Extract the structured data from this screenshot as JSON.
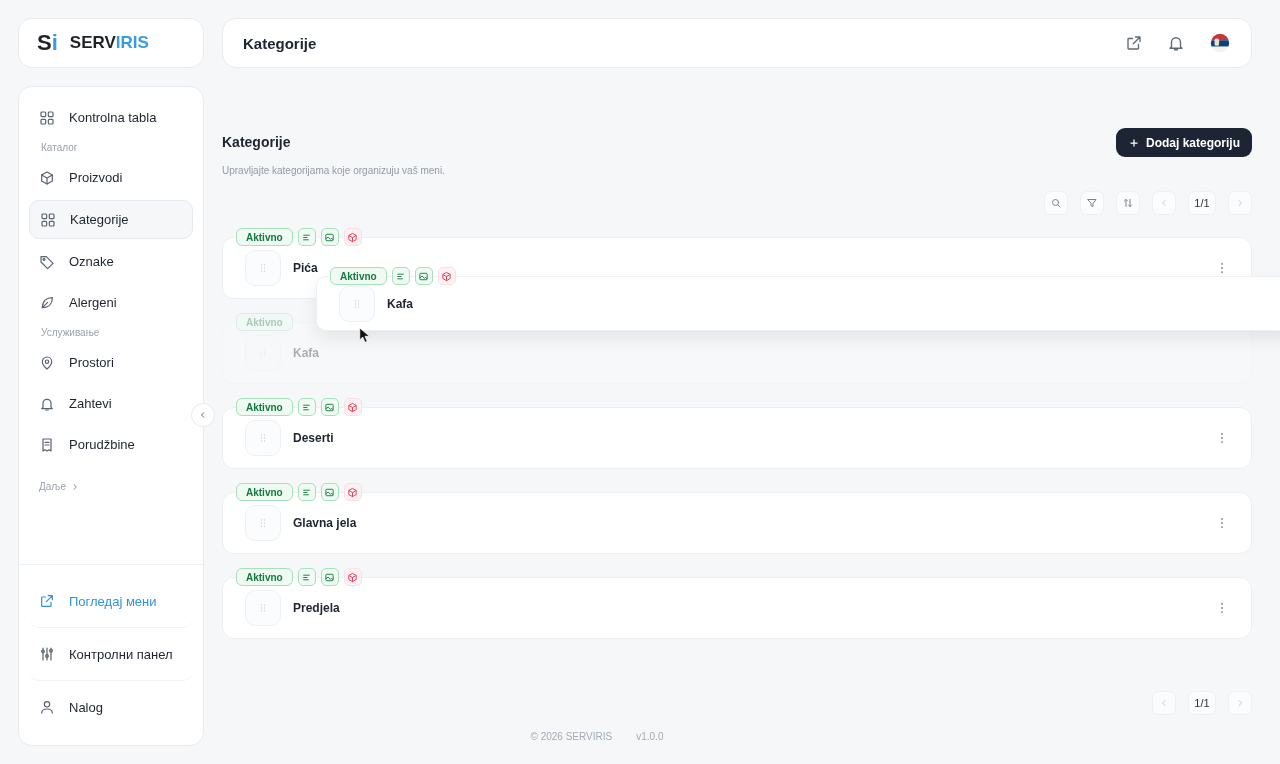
{
  "brand": {
    "mark_s": "S",
    "mark_i": "i",
    "name_a": "SERV",
    "name_b": "IRIS"
  },
  "header": {
    "title": "Kategorije"
  },
  "sidebar": {
    "items": [
      {
        "kind": "item",
        "label": "Kontrolna tabla",
        "selected": false
      },
      {
        "kind": "section",
        "label": "Каталог"
      },
      {
        "kind": "item",
        "label": "Proizvodi",
        "selected": false
      },
      {
        "kind": "item",
        "label": "Kategorije",
        "selected": true
      },
      {
        "kind": "item",
        "label": "Oznake",
        "selected": false
      },
      {
        "kind": "item",
        "label": "Alergeni",
        "selected": false
      },
      {
        "kind": "section",
        "label": "Услуживање"
      },
      {
        "kind": "item",
        "label": "Prostori",
        "selected": false
      },
      {
        "kind": "item",
        "label": "Zahtevi",
        "selected": false
      },
      {
        "kind": "item",
        "label": "Porudžbine",
        "selected": false
      },
      {
        "kind": "more",
        "label": "Даље"
      }
    ],
    "bottom": [
      {
        "kind": "link",
        "label": "Погледај мени"
      },
      {
        "kind": "item",
        "label": "Контролни панел"
      },
      {
        "kind": "item",
        "label": "Nalog"
      }
    ]
  },
  "page": {
    "title": "Kategorije",
    "subtitle": "Upravljajte kategorijama koje organizuju vaš meni.",
    "add_button": "Dodaj kategoriju"
  },
  "toolbar": {
    "page": "1/1"
  },
  "rows": [
    {
      "kind": "card",
      "status": "Aktivno",
      "has_description": true,
      "has_image": true,
      "has_products": false,
      "name": "Pića"
    },
    {
      "kind": "placeholder",
      "status": "Aktivno",
      "name": "Kafa"
    },
    {
      "kind": "card",
      "status": "Aktivno",
      "has_description": true,
      "has_image": true,
      "has_products": false,
      "name": "Deserti"
    },
    {
      "kind": "card",
      "status": "Aktivno",
      "has_description": true,
      "has_image": true,
      "has_products": false,
      "name": "Glavna jela"
    },
    {
      "kind": "card",
      "status": "Aktivno",
      "has_description": true,
      "has_image": true,
      "has_products": false,
      "name": "Predjela"
    }
  ],
  "dragging": {
    "status": "Aktivno",
    "has_description": true,
    "has_image": true,
    "has_products": false,
    "name": "Kafa"
  },
  "pager": {
    "page": "1/1"
  },
  "footer": {
    "copyright": "© 2026 SERVIRIS",
    "version": "v1.0.0"
  }
}
